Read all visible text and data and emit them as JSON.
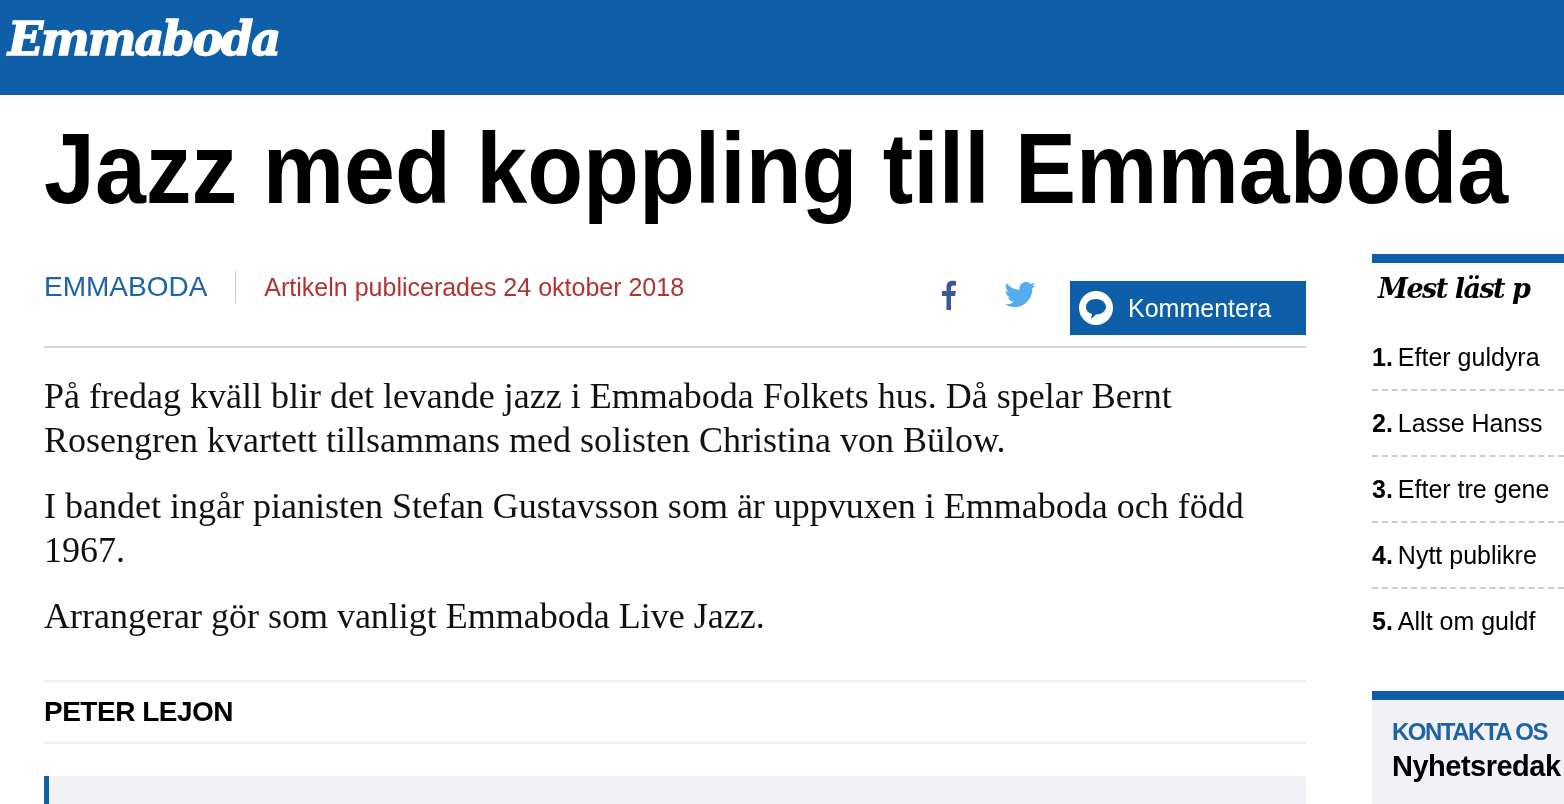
{
  "header": {
    "logo": "Emmaboda"
  },
  "article": {
    "headline": "Jazz med koppling till Emmaboda",
    "section": "EMMABODA",
    "published": "Artikeln publicerades 24 oktober 2018",
    "comment_button": "Kommentera",
    "paragraphs": [
      "På fredag kväll blir det levande jazz i Emmaboda Folkets hus. Då spelar Bernt Rosengren kvartett tillsammans med solisten Christina von Bülow.",
      "I bandet ingår pianisten Stefan Gustavsson som är uppvuxen i Emmaboda och född 1967.",
      "Arrangerar gör som vanligt Emmaboda Live Jazz."
    ],
    "author": "PETER LEJON"
  },
  "sidebar": {
    "most_read": {
      "title": "Mest läst p",
      "items": [
        {
          "number": "1.",
          "text": "Efter guldyra"
        },
        {
          "number": "2.",
          "text": "Lasse Hanss"
        },
        {
          "number": "3.",
          "text": "Efter tre gene"
        },
        {
          "number": "4.",
          "text": "Nytt publikre"
        },
        {
          "number": "5.",
          "text": "Allt om guldf"
        }
      ]
    },
    "contact": {
      "label": "KONTAKTA OS",
      "title": "Nyhetsredak"
    }
  }
}
